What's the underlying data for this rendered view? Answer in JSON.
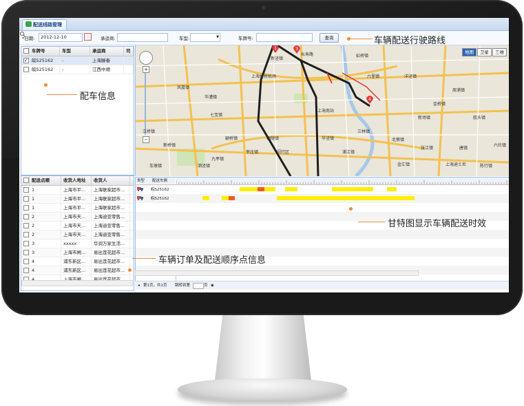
{
  "window": {
    "tab_title": "配送线路管理"
  },
  "filter": {
    "date_label": "*日期:",
    "date_value": "2012-12-10",
    "carrier_label": "承运商:",
    "vehicle_type_label": "车型:",
    "plate_label": "车牌号:",
    "query_button": "查询"
  },
  "vehicle_grid": {
    "headers": [
      "车牌号",
      "车型",
      "承运商",
      "司"
    ],
    "rows": [
      {
        "plate": "皖S25162",
        "type": "-",
        "carrier": "上海滕春",
        "checked": true
      },
      {
        "plate": "皖S25162",
        "type": "-",
        "carrier": "江西中顺",
        "checked": false
      }
    ]
  },
  "order_grid": {
    "headers": [
      "配送点顺",
      "收货人地址",
      "收货人"
    ],
    "rows": [
      {
        "seq": "1",
        "addr": "上海市平...",
        "name": "上海联家超市..."
      },
      {
        "seq": "1",
        "addr": "上海市平...",
        "name": "上海联家超市..."
      },
      {
        "seq": "1",
        "addr": "上海市平...",
        "name": "上海联家超市..."
      },
      {
        "seq": "2",
        "addr": "上海市天...",
        "name": "上海迪亚零售..."
      },
      {
        "seq": "2",
        "addr": "上海市天...",
        "name": "上海迪亚零售..."
      },
      {
        "seq": "2",
        "addr": "上海市天...",
        "name": "上海迪亚零售..."
      },
      {
        "seq": "3",
        "addr": "xxxxx",
        "name": "华润万家生活..."
      },
      {
        "seq": "3",
        "addr": "上海市闸...",
        "name": "易出莲花超市..."
      },
      {
        "seq": "4",
        "addr": "浦东新区...",
        "name": "易出莲花超市..."
      },
      {
        "seq": "4",
        "addr": "浦东新区...",
        "name": "易出莲花超市..."
      },
      {
        "seq": "4",
        "addr": "上海市闸...",
        "name": "易出莲花超市..."
      }
    ]
  },
  "map": {
    "types": [
      "地图",
      "卫星",
      "三维"
    ],
    "active_type": "地图",
    "labels": [
      "新泾镇",
      "长寿路",
      "上海虹桥机场",
      "凤凰镇",
      "七宝镇",
      "上海南站",
      "虹桥镇",
      "颛桥镇",
      "梅陇镇",
      "闵行区",
      "莘庄镇",
      "华泾镇",
      "三林镇",
      "北蔡镇",
      "张江镇",
      "唐镇",
      "六里镇",
      "周浦镇",
      "航头镇",
      "上海迪士尼",
      "陈行镇",
      "金汇镇",
      "新场镇",
      "六灶镇",
      "江桥镇",
      "华漕镇",
      "新桥镇",
      "车墩镇",
      "泗泾镇",
      "九亭镇",
      "浦江镇",
      "洋泾镇",
      "金桥镇"
    ],
    "markers": [
      "1",
      "3",
      "4"
    ]
  },
  "gantt": {
    "col_type": "类型",
    "col_vehicle": "配送车辆",
    "rows": [
      {
        "vehicle": "皖S25162"
      },
      {
        "vehicle": "皖S25162"
      }
    ]
  },
  "pager": {
    "text": "第1页，共1页",
    "jump": "跳转到第",
    "page_suffix": "页"
  },
  "annotations": {
    "route": "车辆配送行驶路线",
    "vehicle_info": "配车信息",
    "gantt": "甘特图显示车辆配送时效",
    "orders": "车辆订单及配送顺序点信息"
  },
  "colors": {
    "bar": "#ffee00",
    "bar_alert": "#f25c20",
    "route": "#1f1f1f",
    "accent": "#f08a3c"
  }
}
